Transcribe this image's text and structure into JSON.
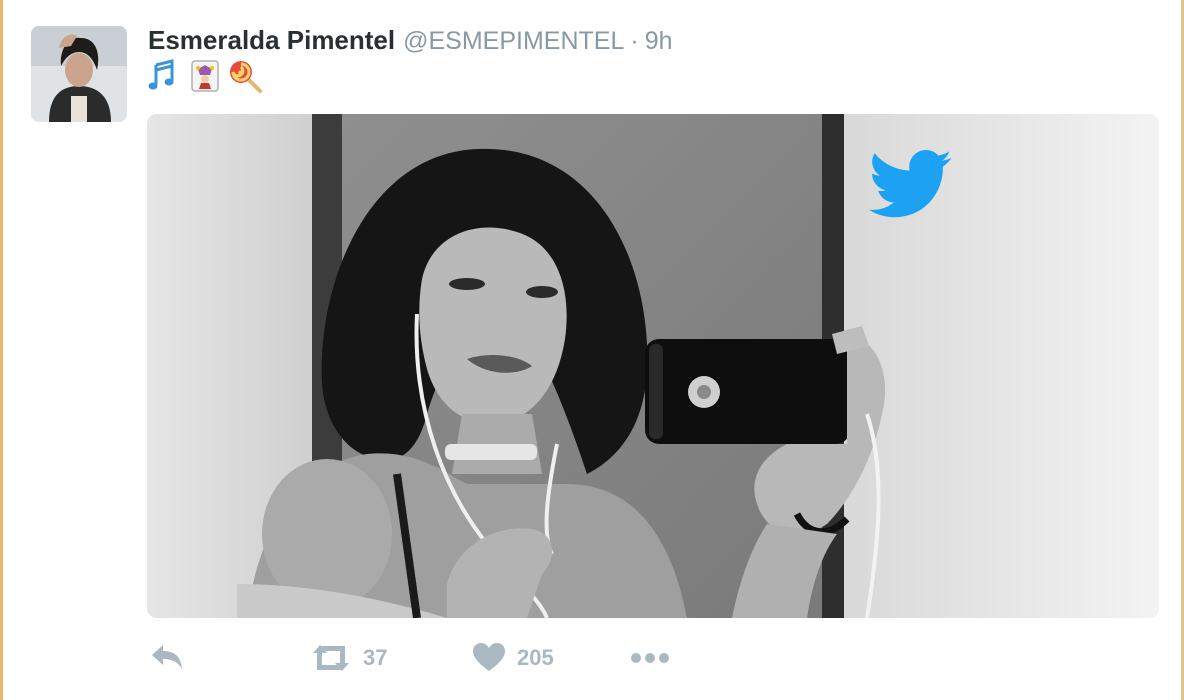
{
  "tweet": {
    "fullname": "Esmeralda Pimentel",
    "username": "@ESMEPIMENTEL",
    "separator": "·",
    "time": "9h",
    "emojis": [
      "musical-notes",
      "jester-card",
      "lollipop"
    ]
  },
  "media": {
    "watermark": "twitter-bird-logo"
  },
  "actions": {
    "reply_icon": "reply-icon",
    "retweet_icon": "retweet-icon",
    "retweet_count": "37",
    "like_icon": "heart-icon",
    "like_count": "205",
    "more_icon": "more-dots-icon"
  },
  "colors": {
    "name": "#292f33",
    "meta": "#8899a6",
    "action": "#aab8c2",
    "twitter_blue": "#1da1f2"
  }
}
